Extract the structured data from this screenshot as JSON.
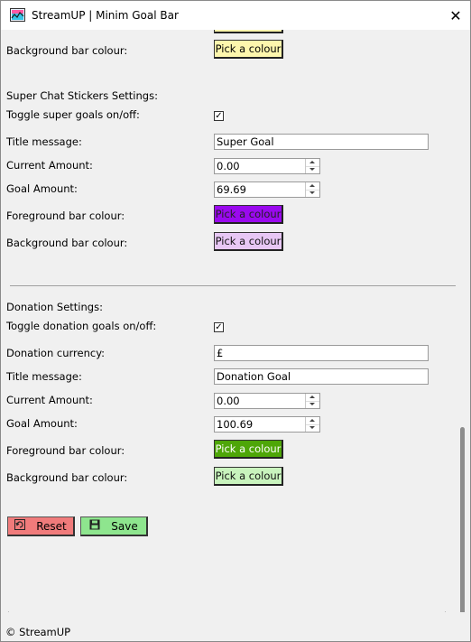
{
  "window": {
    "title": "StreamUP | Minim Goal Bar",
    "close_glyph": "✕"
  },
  "top_section": {
    "background_bar_label": "Background bar colour:",
    "background_bar_button": "Pick a colour"
  },
  "super_chat": {
    "heading": "Super Chat  Stickers Settings:",
    "toggle_label": "Toggle super goals on/off:",
    "toggle_checked": true,
    "title_label": "Title message:",
    "title_value": "Super Goal",
    "current_label": "Current Amount:",
    "current_value": "0.00",
    "goal_label": "Goal Amount:",
    "goal_value": "69.69",
    "fg_label": "Foreground bar colour:",
    "fg_button": "Pick a colour",
    "bg_label": "Background bar colour:",
    "bg_button": "Pick a colour"
  },
  "donation": {
    "heading": "Donation Settings:",
    "toggle_label": "Toggle donation goals on/off:",
    "toggle_checked": true,
    "currency_label": "Donation currency:",
    "currency_value": "£",
    "title_label": "Title message:",
    "title_value": "Donation Goal",
    "current_label": "Current Amount:",
    "current_value": "0.00",
    "goal_label": "Goal Amount:",
    "goal_value": "100.69",
    "fg_label": "Foreground bar colour:",
    "fg_button": "Pick a colour",
    "bg_label": "Background bar colour:",
    "bg_button": "Pick a colour"
  },
  "actions": {
    "reset_label": "Reset",
    "save_label": "Save"
  },
  "footer": {
    "copyright": "© StreamUP"
  },
  "colors": {
    "top_bg_bar": "#fdf6ad",
    "super_fg_bar": "#9a09ee",
    "super_bg_bar": "#e7c7f4",
    "donation_fg_bar": "#4ea608",
    "donation_bg_bar": "#c8f3bd",
    "reset_button": "#f07b7b",
    "save_button": "#8ee58e"
  },
  "icons": [
    "app-icon",
    "close-icon",
    "check-icon",
    "reset-icon",
    "save-icon",
    "spin-up-icon",
    "spin-down-icon"
  ]
}
